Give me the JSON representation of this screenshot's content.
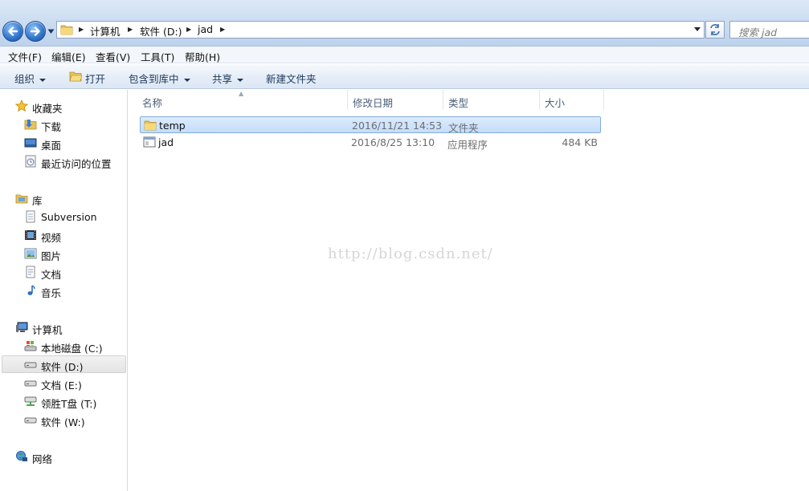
{
  "address_bar": {
    "breadcrumbs": [
      "计算机",
      "软件 (D:)",
      "jad"
    ],
    "search_placeholder": "搜索 jad"
  },
  "menu": [
    "文件(F)",
    "编辑(E)",
    "查看(V)",
    "工具(T)",
    "帮助(H)"
  ],
  "toolbar": {
    "organize": "组织",
    "open": "打开",
    "include_in_library": "包含到库中",
    "share": "共享",
    "new_folder": "新建文件夹"
  },
  "nav": {
    "favorites": {
      "label": "收藏夹",
      "items": [
        "下载",
        "桌面",
        "最近访问的位置"
      ]
    },
    "libraries": {
      "label": "库",
      "items": [
        "Subversion",
        "视频",
        "图片",
        "文档",
        "音乐"
      ]
    },
    "computer": {
      "label": "计算机",
      "items": [
        "本地磁盘 (C:)",
        "软件 (D:)",
        "文档 (E:)",
        "领胜T盘 (T:)",
        "软件 (W:)"
      ],
      "selected": "软件 (D:)"
    },
    "network": {
      "label": "网络"
    }
  },
  "columns": [
    "名称",
    "修改日期",
    "类型",
    "大小"
  ],
  "files": [
    {
      "name": "temp",
      "modified": "2016/11/21 14:53",
      "type": "文件夹",
      "size": "",
      "icon": "folder-icon",
      "selected": true
    },
    {
      "name": "jad",
      "modified": "2016/8/25 13:10",
      "type": "应用程序",
      "size": "484 KB",
      "icon": "application-icon",
      "selected": false
    }
  ],
  "watermark": "http://blog.csdn.net/",
  "colors": {
    "selection": "#cce0f8",
    "toolbar_text": "#1e395b",
    "header_text": "#4c607a"
  }
}
